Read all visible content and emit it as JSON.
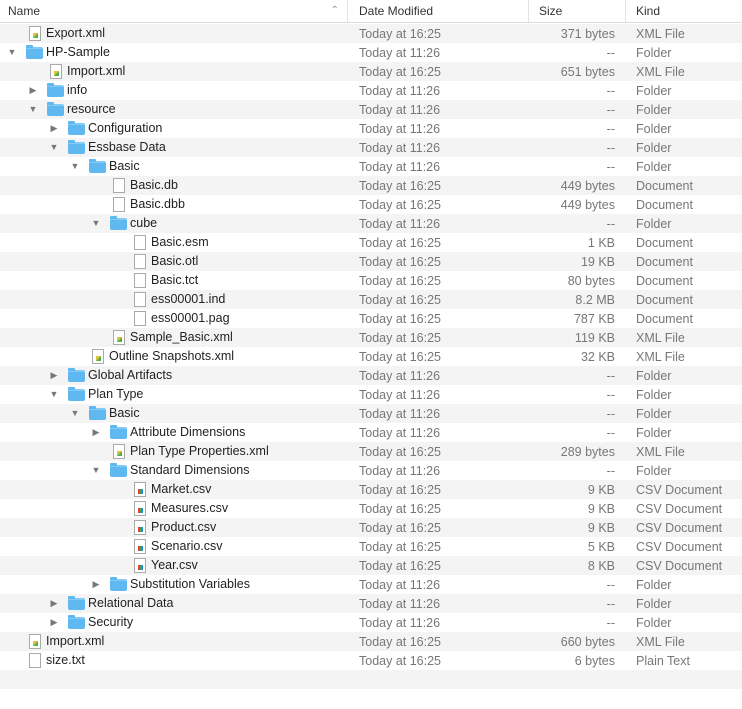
{
  "header": {
    "name": "Name",
    "date": "Date Modified",
    "size": "Size",
    "kind": "Kind",
    "sort": "chevron-up-icon"
  },
  "colors": {
    "folder": "#5fb8ef",
    "stripe": "#f4f4f5",
    "text_secondary": "#777777"
  },
  "rows": [
    {
      "level": 0,
      "name": "Export.xml",
      "date": "Today at 16:25",
      "size": "371 bytes",
      "kind": "XML File",
      "icon": "xml"
    },
    {
      "level": 0,
      "name": "HP-Sample",
      "date": "Today at 11:26",
      "size": "--",
      "kind": "Folder",
      "icon": "folder",
      "open": true
    },
    {
      "level": 1,
      "name": "Import.xml",
      "date": "Today at 16:25",
      "size": "651 bytes",
      "kind": "XML File",
      "icon": "xml"
    },
    {
      "level": 1,
      "name": "info",
      "date": "Today at 11:26",
      "size": "--",
      "kind": "Folder",
      "icon": "folder",
      "open": false
    },
    {
      "level": 1,
      "name": "resource",
      "date": "Today at 11:26",
      "size": "--",
      "kind": "Folder",
      "icon": "folder",
      "open": true
    },
    {
      "level": 2,
      "name": "Configuration",
      "date": "Today at 11:26",
      "size": "--",
      "kind": "Folder",
      "icon": "folder",
      "open": false
    },
    {
      "level": 2,
      "name": "Essbase Data",
      "date": "Today at 11:26",
      "size": "--",
      "kind": "Folder",
      "icon": "folder",
      "open": true
    },
    {
      "level": 3,
      "name": "Basic",
      "date": "Today at 11:26",
      "size": "--",
      "kind": "Folder",
      "icon": "folder",
      "open": true
    },
    {
      "level": 4,
      "name": "Basic.db",
      "date": "Today at 16:25",
      "size": "449 bytes",
      "kind": "Document",
      "icon": "doc"
    },
    {
      "level": 4,
      "name": "Basic.dbb",
      "date": "Today at 16:25",
      "size": "449 bytes",
      "kind": "Document",
      "icon": "doc"
    },
    {
      "level": 4,
      "name": "cube",
      "date": "Today at 11:26",
      "size": "--",
      "kind": "Folder",
      "icon": "folder",
      "open": true
    },
    {
      "level": 5,
      "name": "Basic.esm",
      "date": "Today at 16:25",
      "size": "1 KB",
      "kind": "Document",
      "icon": "doc"
    },
    {
      "level": 5,
      "name": "Basic.otl",
      "date": "Today at 16:25",
      "size": "19 KB",
      "kind": "Document",
      "icon": "doc"
    },
    {
      "level": 5,
      "name": "Basic.tct",
      "date": "Today at 16:25",
      "size": "80 bytes",
      "kind": "Document",
      "icon": "doc"
    },
    {
      "level": 5,
      "name": "ess00001.ind",
      "date": "Today at 16:25",
      "size": "8.2 MB",
      "kind": "Document",
      "icon": "doc"
    },
    {
      "level": 5,
      "name": "ess00001.pag",
      "date": "Today at 16:25",
      "size": "787 KB",
      "kind": "Document",
      "icon": "doc"
    },
    {
      "level": 4,
      "name": "Sample_Basic.xml",
      "date": "Today at 16:25",
      "size": "119 KB",
      "kind": "XML File",
      "icon": "xml"
    },
    {
      "level": 3,
      "name": "Outline Snapshots.xml",
      "date": "Today at 16:25",
      "size": "32 KB",
      "kind": "XML File",
      "icon": "xml"
    },
    {
      "level": 2,
      "name": "Global Artifacts",
      "date": "Today at 11:26",
      "size": "--",
      "kind": "Folder",
      "icon": "folder",
      "open": false
    },
    {
      "level": 2,
      "name": "Plan Type",
      "date": "Today at 11:26",
      "size": "--",
      "kind": "Folder",
      "icon": "folder",
      "open": true
    },
    {
      "level": 3,
      "name": "Basic",
      "date": "Today at 11:26",
      "size": "--",
      "kind": "Folder",
      "icon": "folder",
      "open": true
    },
    {
      "level": 4,
      "name": "Attribute Dimensions",
      "date": "Today at 11:26",
      "size": "--",
      "kind": "Folder",
      "icon": "folder",
      "open": false
    },
    {
      "level": 4,
      "name": "Plan Type Properties.xml",
      "date": "Today at 16:25",
      "size": "289 bytes",
      "kind": "XML File",
      "icon": "xml"
    },
    {
      "level": 4,
      "name": "Standard Dimensions",
      "date": "Today at 11:26",
      "size": "--",
      "kind": "Folder",
      "icon": "folder",
      "open": true
    },
    {
      "level": 5,
      "name": "Market.csv",
      "date": "Today at 16:25",
      "size": "9 KB",
      "kind": "CSV Document",
      "icon": "csv"
    },
    {
      "level": 5,
      "name": "Measures.csv",
      "date": "Today at 16:25",
      "size": "9 KB",
      "kind": "CSV Document",
      "icon": "csv"
    },
    {
      "level": 5,
      "name": "Product.csv",
      "date": "Today at 16:25",
      "size": "9 KB",
      "kind": "CSV Document",
      "icon": "csv"
    },
    {
      "level": 5,
      "name": "Scenario.csv",
      "date": "Today at 16:25",
      "size": "5 KB",
      "kind": "CSV Document",
      "icon": "csv"
    },
    {
      "level": 5,
      "name": "Year.csv",
      "date": "Today at 16:25",
      "size": "8 KB",
      "kind": "CSV Document",
      "icon": "csv"
    },
    {
      "level": 4,
      "name": "Substitution Variables",
      "date": "Today at 11:26",
      "size": "--",
      "kind": "Folder",
      "icon": "folder",
      "open": false
    },
    {
      "level": 2,
      "name": "Relational Data",
      "date": "Today at 11:26",
      "size": "--",
      "kind": "Folder",
      "icon": "folder",
      "open": false
    },
    {
      "level": 2,
      "name": "Security",
      "date": "Today at 11:26",
      "size": "--",
      "kind": "Folder",
      "icon": "folder",
      "open": false
    },
    {
      "level": 0,
      "name": "Import.xml",
      "date": "Today at 16:25",
      "size": "660 bytes",
      "kind": "XML File",
      "icon": "xml"
    },
    {
      "level": 0,
      "name": "size.txt",
      "date": "Today at 16:25",
      "size": "6 bytes",
      "kind": "Plain Text",
      "icon": "txt"
    }
  ]
}
